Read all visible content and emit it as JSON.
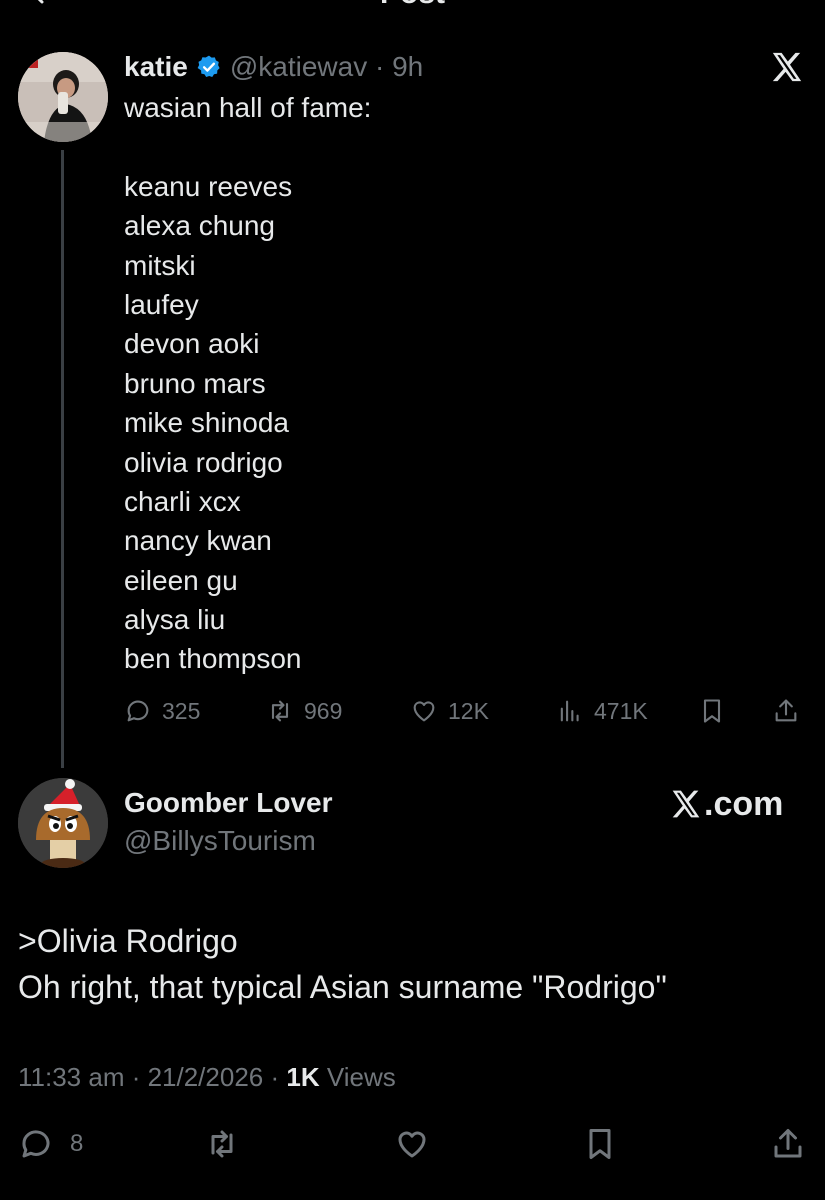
{
  "header": {
    "title": "Post"
  },
  "tweet": {
    "author_name": "katie",
    "handle_time": "@katiewav · 9h",
    "lines": [
      "wasian hall of fame:",
      "",
      "keanu reeves",
      "alexa chung",
      "mitski",
      "laufey",
      "devon aoki",
      "bruno mars",
      "mike shinoda",
      "olivia rodrigo",
      "charli xcx",
      "nancy kwan",
      "eileen gu",
      "alysa liu",
      "ben thompson"
    ],
    "stats": {
      "replies": "325",
      "reposts": "969",
      "likes": "12K",
      "views": "471K"
    }
  },
  "reply": {
    "author_name": "Goomber Lover",
    "handle": "@BillysTourism",
    "watermark": ".com",
    "lines": [
      ">Olivia Rodrigo",
      "Oh right, that typical Asian surname \"Rodrigo\""
    ],
    "meta_time": "11:33 am · 21/2/2026 · ",
    "meta_views_count": "1K",
    "meta_views_label": " Views",
    "reply_count": "8"
  },
  "colors": {
    "background": "#000000",
    "text": "#e7e9ea",
    "muted": "#71767b",
    "verified": "#1d9bf0"
  },
  "icons": [
    "back-arrow-icon",
    "verified-badge-icon",
    "x-logo-icon",
    "reply-icon",
    "repost-icon",
    "like-icon",
    "views-icon",
    "bookmark-icon",
    "share-icon"
  ]
}
